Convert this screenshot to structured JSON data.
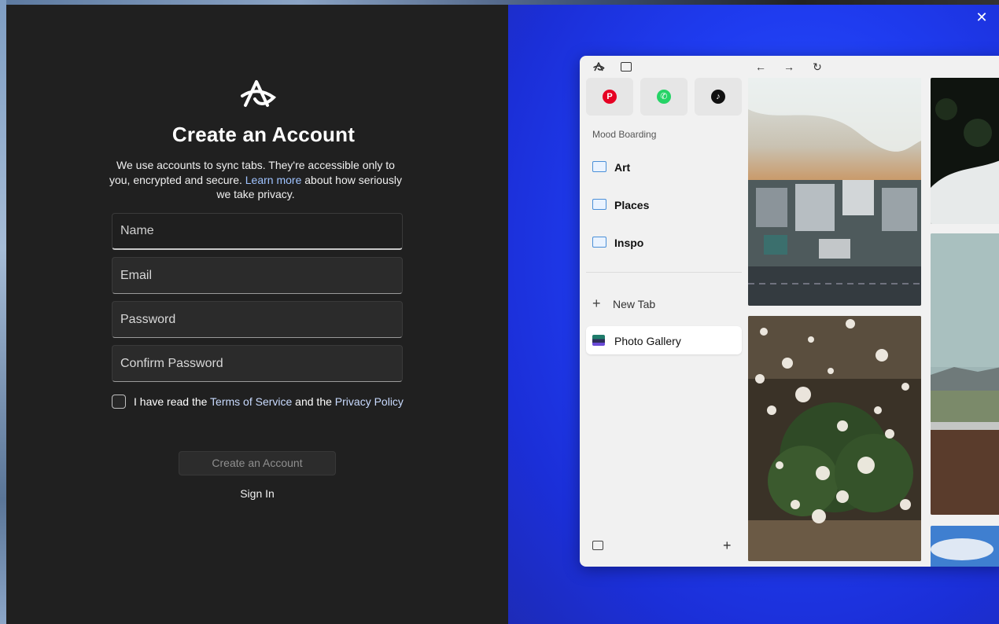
{
  "window": {
    "close_glyph": "✕"
  },
  "signup": {
    "title": "Create an Account",
    "subtitle_pre": "We use accounts to sync tabs. They're accessible only to you, encrypted and secure. ",
    "subtitle_link": "Learn more",
    "subtitle_post": " about how seriously we take privacy.",
    "fields": {
      "name_placeholder": "Name",
      "email_placeholder": "Email",
      "password_placeholder": "Password",
      "confirm_placeholder": "Confirm Password"
    },
    "terms": {
      "pre": "I have read the ",
      "tos": "Terms of Service",
      "mid": " and the ",
      "privacy": "Privacy Policy"
    },
    "create_button": "Create an Account",
    "signin_link": "Sign In"
  },
  "mock_browser": {
    "nav": {
      "back": "←",
      "forward": "→",
      "reload": "↻"
    },
    "pinned": [
      {
        "icon": "pinterest-icon",
        "glyph": "P",
        "color": "#e60023"
      },
      {
        "icon": "whatsapp-icon",
        "glyph": "✆",
        "color": "#25d366"
      },
      {
        "icon": "tiktok-icon",
        "glyph": "♪",
        "color": "#111111"
      }
    ],
    "section_label": "Mood Boarding",
    "folders": [
      "Art",
      "Places",
      "Inspo"
    ],
    "new_tab_label": "New Tab",
    "active_tab_label": "Photo Gallery",
    "add_glyph": "+"
  },
  "colors": {
    "panel_bg": "#202020",
    "promo_blue": "#1f3cf0",
    "link_blue": "#9fc3ff"
  }
}
